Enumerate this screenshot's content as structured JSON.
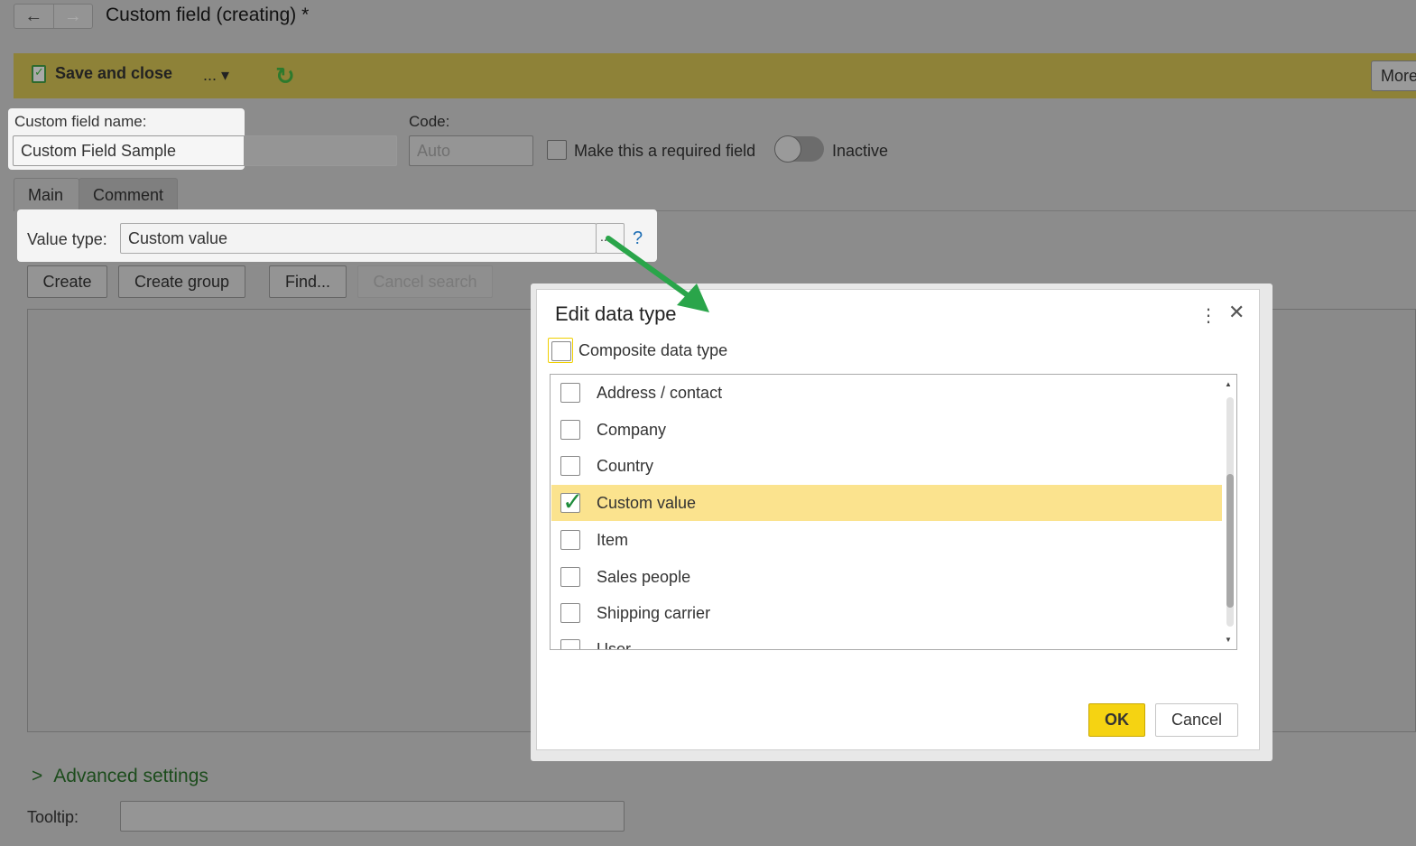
{
  "window": {
    "title": "Custom field (creating) *",
    "back_icon": "←",
    "forward_icon": "→"
  },
  "toolbar": {
    "save_close_label": "Save and close",
    "more_label": "... ▾",
    "refresh_icon": "↻",
    "more_right_label": "More"
  },
  "form": {
    "name_label": "Custom field name:",
    "name_value": "Custom Field Sample",
    "code_label": "Code:",
    "code_placeholder": "Auto",
    "required_label": "Make this a required field",
    "inactive_label": "Inactive",
    "value_type_label": "Value type:",
    "value_type_value": "Custom value",
    "select_button": "...",
    "help_icon": "?",
    "tooltip_label": "Tooltip:",
    "advanced_label": "Advanced settings",
    "advanced_icon": ">"
  },
  "tabs": [
    {
      "label": "Main"
    },
    {
      "label": "Comment"
    }
  ],
  "list_buttons": {
    "create": "Create",
    "create_group": "Create group",
    "find": "Find...",
    "cancel_search": "Cancel search"
  },
  "dialog": {
    "title": "Edit data type",
    "menu_icon": "⋮",
    "close_icon": "✕",
    "composite_label": "Composite data type",
    "items": [
      {
        "label": "Address / contact",
        "checked": false
      },
      {
        "label": "Company",
        "checked": false
      },
      {
        "label": "Country",
        "checked": false
      },
      {
        "label": "Custom value",
        "checked": true
      },
      {
        "label": "Item",
        "checked": false
      },
      {
        "label": "Sales people",
        "checked": false
      },
      {
        "label": "Shipping carrier",
        "checked": false
      },
      {
        "label": "User",
        "checked": false
      }
    ],
    "ok_label": "OK",
    "cancel_label": "Cancel"
  },
  "colors": {
    "accent_yellow": "#f5d312",
    "selected_row": "#fbe38e",
    "check_green": "#1e8c3a",
    "annotation_arrow": "#2aa54a"
  }
}
